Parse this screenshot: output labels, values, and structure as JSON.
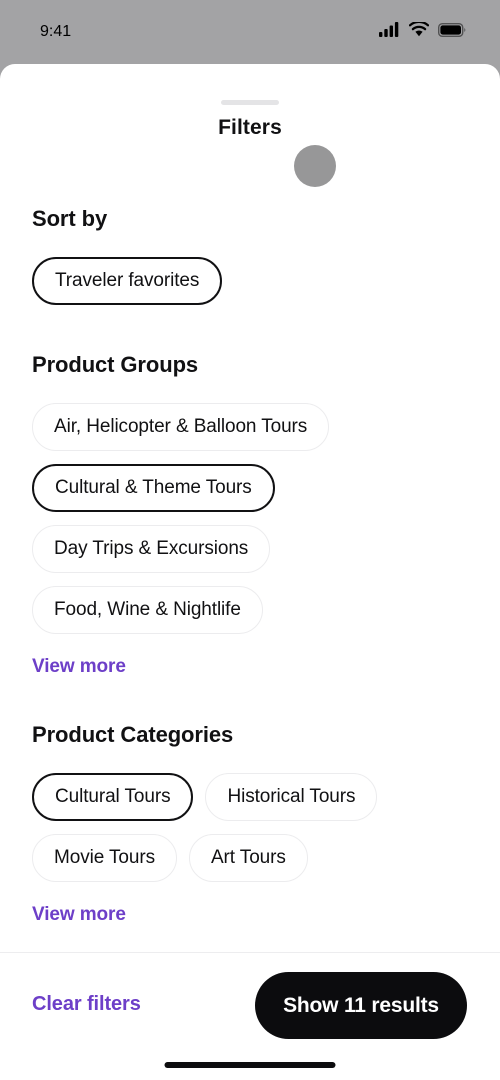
{
  "status_bar": {
    "time": "9:41",
    "icons": [
      "cellular-signal-icon",
      "wifi-icon",
      "battery-icon"
    ]
  },
  "sheet": {
    "title": "Filters",
    "handle": "drag-handle"
  },
  "sections": [
    {
      "id": "sort-by",
      "title": "Sort by",
      "layout": "block",
      "options": [
        {
          "label": "Traveler favorites",
          "selected": true
        }
      ],
      "view_more": null
    },
    {
      "id": "product-groups",
      "title": "Product Groups",
      "layout": "block",
      "options": [
        {
          "label": "Air, Helicopter & Balloon Tours",
          "selected": false
        },
        {
          "label": "Cultural & Theme Tours",
          "selected": true
        },
        {
          "label": "Day Trips & Excursions",
          "selected": false
        },
        {
          "label": "Food, Wine & Nightlife",
          "selected": false
        }
      ],
      "view_more": "View more"
    },
    {
      "id": "product-categories",
      "title": "Product Categories",
      "layout": "wrap",
      "options": [
        {
          "label": "Cultural Tours",
          "selected": true
        },
        {
          "label": "Historical Tours",
          "selected": false
        },
        {
          "label": "Movie Tours",
          "selected": false
        },
        {
          "label": "Art Tours",
          "selected": false
        }
      ],
      "view_more": "View more"
    }
  ],
  "bottom_bar": {
    "clear_label": "Clear filters",
    "show_results_label": "Show 11 results",
    "results_count": 11
  },
  "colors": {
    "accent_purple": "#6d3fc8",
    "primary_dark": "#0c0c0e",
    "pill_border": "#ececee",
    "backdrop_gray": "#a3a3a5",
    "touch_indicator": "#979798"
  }
}
